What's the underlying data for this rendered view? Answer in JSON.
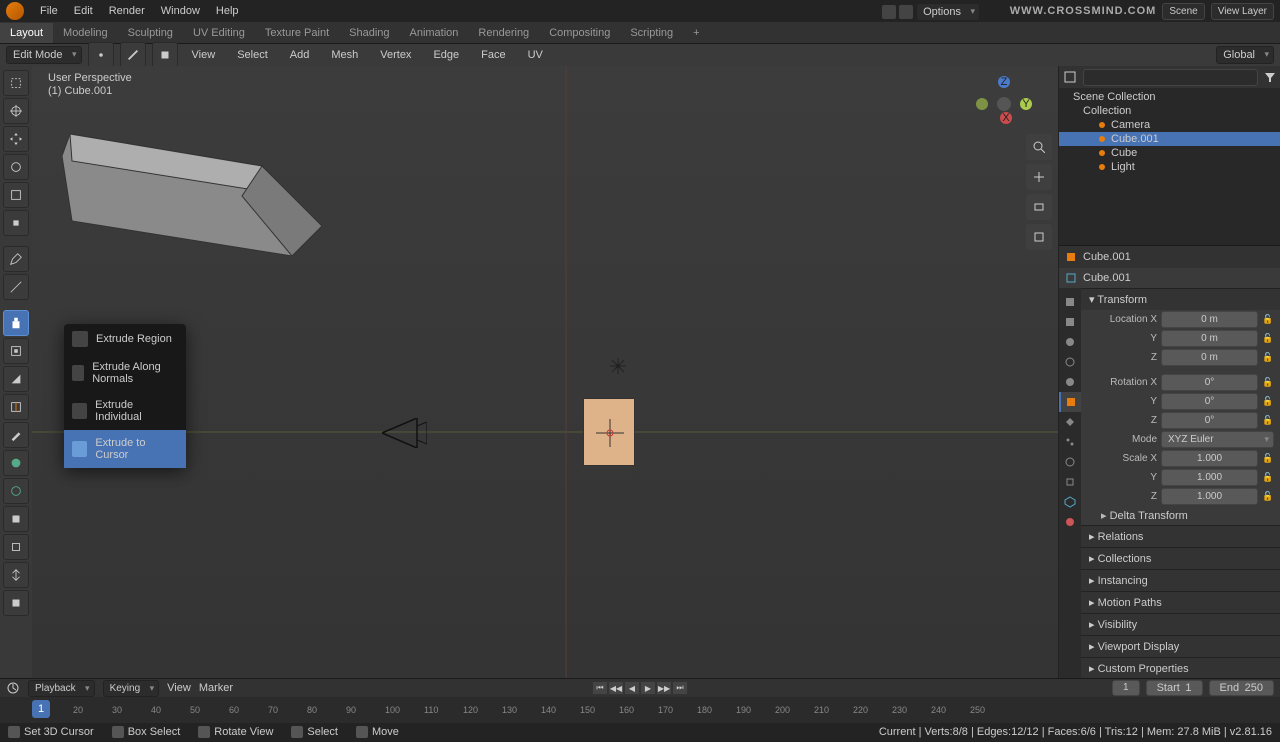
{
  "topMenu": [
    "File",
    "Edit",
    "Render",
    "Window",
    "Help"
  ],
  "brand": "WWW.CROSSMIND.COM",
  "sceneLabel": "Scene",
  "viewLayerLabel": "View Layer",
  "workspaces": [
    "Layout",
    "Modeling",
    "Sculpting",
    "UV Editing",
    "Texture Paint",
    "Shading",
    "Animation",
    "Rendering",
    "Compositing",
    "Scripting"
  ],
  "activeWorkspace": "Layout",
  "editModeLabel": "Edit Mode",
  "viewportMenus": [
    "View",
    "Select",
    "Add",
    "Mesh",
    "Vertex",
    "Edge",
    "Face",
    "UV"
  ],
  "orientation": "Global",
  "optionsLabel": "Options",
  "vpInfo": {
    "line1": "User Perspective",
    "line2": "(1) Cube.001"
  },
  "extrudeOptions": [
    "Extrude Region",
    "Extrude Along Normals",
    "Extrude Individual",
    "Extrude to Cursor"
  ],
  "extrudeSelected": 3,
  "outliner": {
    "root": "Scene Collection",
    "collection": "Collection",
    "items": [
      "Camera",
      "Cube.001",
      "Cube",
      "Light"
    ],
    "selected": "Cube.001"
  },
  "obj": {
    "header1": "Cube.001",
    "header2": "Cube.001"
  },
  "transform": {
    "panel": "Transform",
    "loc": {
      "label": "Location X",
      "x": "0 m",
      "y": "0 m",
      "z": "0 m"
    },
    "rot": {
      "label": "Rotation X",
      "x": "0°",
      "y": "0°",
      "z": "0°",
      "mode": "XYZ Euler",
      "modeLabel": "Mode"
    },
    "scale": {
      "label": "Scale X",
      "x": "1.000",
      "y": "1.000",
      "z": "1.000"
    },
    "delta": "Delta Transform"
  },
  "panels": [
    "Relations",
    "Collections",
    "Instancing",
    "Motion Paths",
    "Visibility",
    "Viewport Display",
    "Custom Properties"
  ],
  "timeline": {
    "menus": [
      "Playback",
      "Keying",
      "View",
      "Marker"
    ],
    "current": "1",
    "start": "Start",
    "startVal": "1",
    "end": "End",
    "endVal": "250",
    "ticks": [
      "10",
      "20",
      "30",
      "40",
      "50",
      "60",
      "70",
      "80",
      "90",
      "100",
      "110",
      "120",
      "130",
      "140",
      "150",
      "160",
      "170",
      "180",
      "190",
      "200",
      "210",
      "220",
      "230",
      "240",
      "250"
    ]
  },
  "status": {
    "left": [
      "Set 3D Cursor",
      "Box Select",
      "Rotate View",
      "Select",
      "Move"
    ],
    "right": "Current | Verts:8/8 | Edges:12/12 | Faces:6/6 | Tris:12 | Mem: 27.8 MiB | v2.81.16"
  }
}
